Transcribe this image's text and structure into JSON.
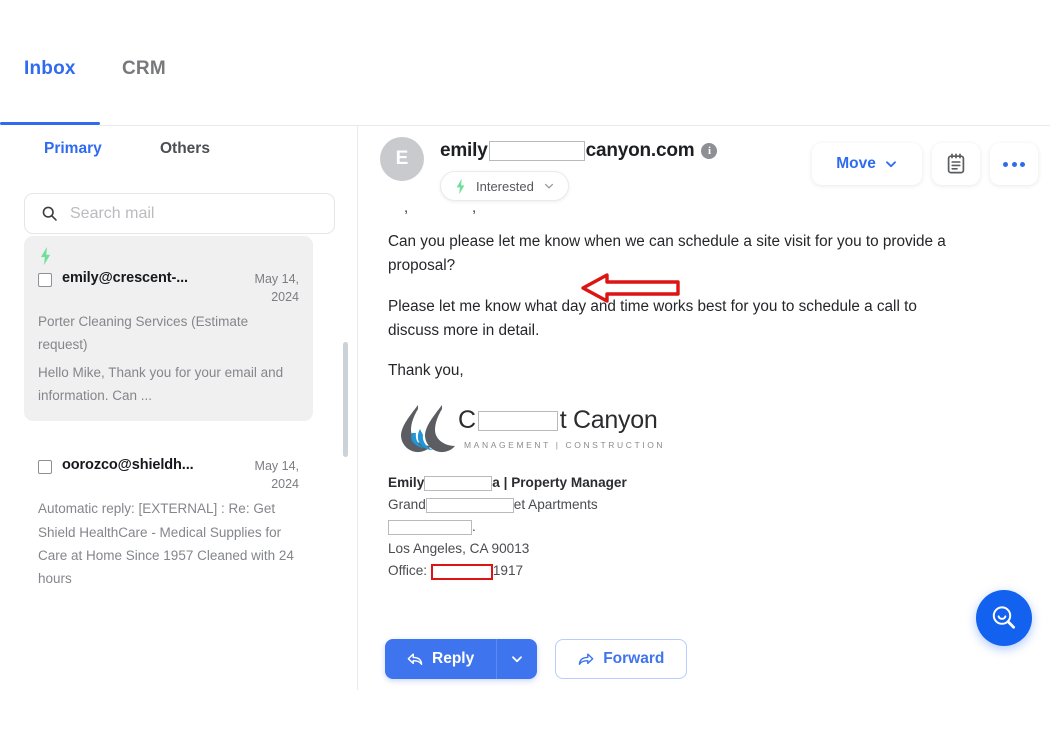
{
  "top_tabs": [
    {
      "label": "Inbox",
      "active": true
    },
    {
      "label": "CRM",
      "active": false
    }
  ],
  "left_panel": {
    "sub_tabs": [
      {
        "label": "Primary",
        "active": true
      },
      {
        "label": "Others",
        "active": false
      }
    ],
    "search": {
      "placeholder": "Search mail",
      "value": "",
      "icon": "search-icon"
    },
    "mails": [
      {
        "flag_icon": "lightning-bolt-icon",
        "from": "emily@crescent-...",
        "date": "May 14,\n2024",
        "date_line1": "May 14,",
        "date_line2": "2024",
        "snippet": "Porter Cleaning Services (Estimate request)",
        "preview": "Hello Mike, Thank you for your email and information. Can ...",
        "selected": true
      },
      {
        "flag_icon": "",
        "from": "oorozco@shieldh...",
        "date_line1": "May 14,",
        "date_line2": "2024",
        "snippet": "Automatic reply: [EXTERNAL] : Re: Get Shield HealthCare - Medical Supplies for Care at Home Since 1957 Cleaned with 24 hours",
        "preview": "",
        "selected": false
      }
    ]
  },
  "reader": {
    "avatar_letter": "E",
    "sender_prefix": "emily",
    "sender_suffix": "canyon.com",
    "info_icon": "info-icon",
    "status_chip": {
      "label": "Interested",
      "icon": "lightning-bolt-icon",
      "caret": "chevron-down-icon"
    },
    "actions": [
      {
        "name": "move-button",
        "label": "Move",
        "icon": "chevron-down-icon"
      },
      {
        "name": "notes-button",
        "label": "",
        "icon": "notepad-icon"
      },
      {
        "name": "more-button",
        "label": "",
        "icon": "ellipsis-icon"
      }
    ],
    "body": {
      "clipped_line": ",          ,",
      "paragraph_1": "Can you please let me know when we can schedule a site visit for you to provide a proposal?",
      "paragraph_2": "Please let me know what day and time works best for you to schedule a call to discuss more in detail.",
      "closing": "Thank you,"
    },
    "signature": {
      "logo_prefix": "C",
      "logo_suffix": "t Canyon",
      "logo_tagline": "MANAGEMENT  |  CONSTRUCTION",
      "name_prefix": "Emily",
      "name_suffix": "a  |  Property Manager",
      "company_prefix": "Grand",
      "company_suffix": "et Apartments",
      "address_line_suffix": ".",
      "city_line": "Los Angeles, CA  90013",
      "office_label": "Office:",
      "office_suffix": "1917"
    },
    "footer": {
      "reply_label": "Reply",
      "reply_icon": "reply-arrow-icon",
      "reply_caret": "chevron-down-icon",
      "forward_label": "Forward",
      "forward_icon": "forward-arrow-icon"
    }
  },
  "fab": {
    "name": "search-fab",
    "icon": "magnifier-smile-icon"
  },
  "annotation": {
    "type": "left-pointing-arrow",
    "color": "#dd1414"
  },
  "colors": {
    "accent_blue": "#2f6bf0",
    "button_blue": "#3f74ef",
    "fab_blue": "#1361ef",
    "annotation_red": "#dd1414",
    "selected_card": "#f0f0f0",
    "flag_green": "#6fdf9a"
  }
}
